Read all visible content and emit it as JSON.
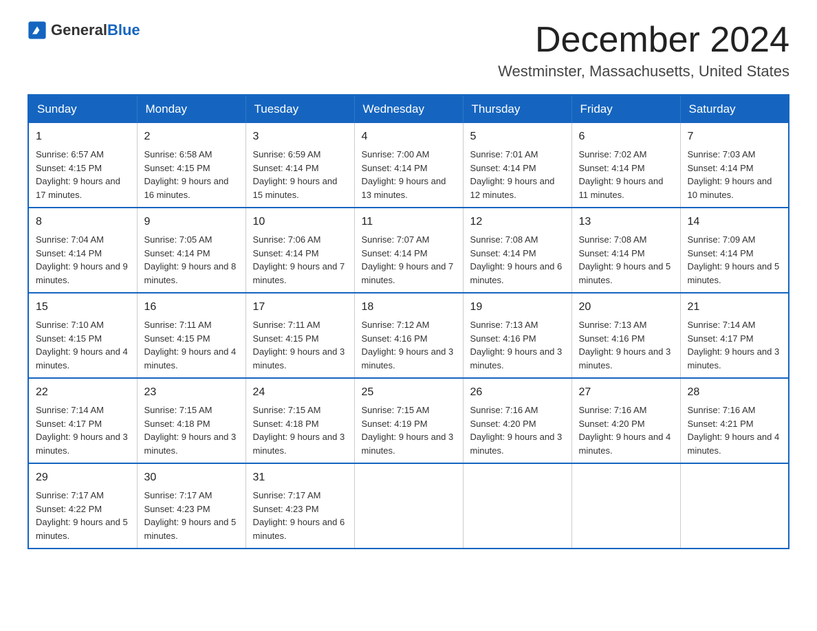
{
  "logo": {
    "text_general": "General",
    "text_blue": "Blue"
  },
  "title": "December 2024",
  "location": "Westminster, Massachusetts, United States",
  "days_of_week": [
    "Sunday",
    "Monday",
    "Tuesday",
    "Wednesday",
    "Thursday",
    "Friday",
    "Saturday"
  ],
  "weeks": [
    [
      {
        "day": "1",
        "sunrise": "Sunrise: 6:57 AM",
        "sunset": "Sunset: 4:15 PM",
        "daylight": "Daylight: 9 hours and 17 minutes."
      },
      {
        "day": "2",
        "sunrise": "Sunrise: 6:58 AM",
        "sunset": "Sunset: 4:15 PM",
        "daylight": "Daylight: 9 hours and 16 minutes."
      },
      {
        "day": "3",
        "sunrise": "Sunrise: 6:59 AM",
        "sunset": "Sunset: 4:14 PM",
        "daylight": "Daylight: 9 hours and 15 minutes."
      },
      {
        "day": "4",
        "sunrise": "Sunrise: 7:00 AM",
        "sunset": "Sunset: 4:14 PM",
        "daylight": "Daylight: 9 hours and 13 minutes."
      },
      {
        "day": "5",
        "sunrise": "Sunrise: 7:01 AM",
        "sunset": "Sunset: 4:14 PM",
        "daylight": "Daylight: 9 hours and 12 minutes."
      },
      {
        "day": "6",
        "sunrise": "Sunrise: 7:02 AM",
        "sunset": "Sunset: 4:14 PM",
        "daylight": "Daylight: 9 hours and 11 minutes."
      },
      {
        "day": "7",
        "sunrise": "Sunrise: 7:03 AM",
        "sunset": "Sunset: 4:14 PM",
        "daylight": "Daylight: 9 hours and 10 minutes."
      }
    ],
    [
      {
        "day": "8",
        "sunrise": "Sunrise: 7:04 AM",
        "sunset": "Sunset: 4:14 PM",
        "daylight": "Daylight: 9 hours and 9 minutes."
      },
      {
        "day": "9",
        "sunrise": "Sunrise: 7:05 AM",
        "sunset": "Sunset: 4:14 PM",
        "daylight": "Daylight: 9 hours and 8 minutes."
      },
      {
        "day": "10",
        "sunrise": "Sunrise: 7:06 AM",
        "sunset": "Sunset: 4:14 PM",
        "daylight": "Daylight: 9 hours and 7 minutes."
      },
      {
        "day": "11",
        "sunrise": "Sunrise: 7:07 AM",
        "sunset": "Sunset: 4:14 PM",
        "daylight": "Daylight: 9 hours and 7 minutes."
      },
      {
        "day": "12",
        "sunrise": "Sunrise: 7:08 AM",
        "sunset": "Sunset: 4:14 PM",
        "daylight": "Daylight: 9 hours and 6 minutes."
      },
      {
        "day": "13",
        "sunrise": "Sunrise: 7:08 AM",
        "sunset": "Sunset: 4:14 PM",
        "daylight": "Daylight: 9 hours and 5 minutes."
      },
      {
        "day": "14",
        "sunrise": "Sunrise: 7:09 AM",
        "sunset": "Sunset: 4:14 PM",
        "daylight": "Daylight: 9 hours and 5 minutes."
      }
    ],
    [
      {
        "day": "15",
        "sunrise": "Sunrise: 7:10 AM",
        "sunset": "Sunset: 4:15 PM",
        "daylight": "Daylight: 9 hours and 4 minutes."
      },
      {
        "day": "16",
        "sunrise": "Sunrise: 7:11 AM",
        "sunset": "Sunset: 4:15 PM",
        "daylight": "Daylight: 9 hours and 4 minutes."
      },
      {
        "day": "17",
        "sunrise": "Sunrise: 7:11 AM",
        "sunset": "Sunset: 4:15 PM",
        "daylight": "Daylight: 9 hours and 3 minutes."
      },
      {
        "day": "18",
        "sunrise": "Sunrise: 7:12 AM",
        "sunset": "Sunset: 4:16 PM",
        "daylight": "Daylight: 9 hours and 3 minutes."
      },
      {
        "day": "19",
        "sunrise": "Sunrise: 7:13 AM",
        "sunset": "Sunset: 4:16 PM",
        "daylight": "Daylight: 9 hours and 3 minutes."
      },
      {
        "day": "20",
        "sunrise": "Sunrise: 7:13 AM",
        "sunset": "Sunset: 4:16 PM",
        "daylight": "Daylight: 9 hours and 3 minutes."
      },
      {
        "day": "21",
        "sunrise": "Sunrise: 7:14 AM",
        "sunset": "Sunset: 4:17 PM",
        "daylight": "Daylight: 9 hours and 3 minutes."
      }
    ],
    [
      {
        "day": "22",
        "sunrise": "Sunrise: 7:14 AM",
        "sunset": "Sunset: 4:17 PM",
        "daylight": "Daylight: 9 hours and 3 minutes."
      },
      {
        "day": "23",
        "sunrise": "Sunrise: 7:15 AM",
        "sunset": "Sunset: 4:18 PM",
        "daylight": "Daylight: 9 hours and 3 minutes."
      },
      {
        "day": "24",
        "sunrise": "Sunrise: 7:15 AM",
        "sunset": "Sunset: 4:18 PM",
        "daylight": "Daylight: 9 hours and 3 minutes."
      },
      {
        "day": "25",
        "sunrise": "Sunrise: 7:15 AM",
        "sunset": "Sunset: 4:19 PM",
        "daylight": "Daylight: 9 hours and 3 minutes."
      },
      {
        "day": "26",
        "sunrise": "Sunrise: 7:16 AM",
        "sunset": "Sunset: 4:20 PM",
        "daylight": "Daylight: 9 hours and 3 minutes."
      },
      {
        "day": "27",
        "sunrise": "Sunrise: 7:16 AM",
        "sunset": "Sunset: 4:20 PM",
        "daylight": "Daylight: 9 hours and 4 minutes."
      },
      {
        "day": "28",
        "sunrise": "Sunrise: 7:16 AM",
        "sunset": "Sunset: 4:21 PM",
        "daylight": "Daylight: 9 hours and 4 minutes."
      }
    ],
    [
      {
        "day": "29",
        "sunrise": "Sunrise: 7:17 AM",
        "sunset": "Sunset: 4:22 PM",
        "daylight": "Daylight: 9 hours and 5 minutes."
      },
      {
        "day": "30",
        "sunrise": "Sunrise: 7:17 AM",
        "sunset": "Sunset: 4:23 PM",
        "daylight": "Daylight: 9 hours and 5 minutes."
      },
      {
        "day": "31",
        "sunrise": "Sunrise: 7:17 AM",
        "sunset": "Sunset: 4:23 PM",
        "daylight": "Daylight: 9 hours and 6 minutes."
      },
      {
        "day": "",
        "sunrise": "",
        "sunset": "",
        "daylight": ""
      },
      {
        "day": "",
        "sunrise": "",
        "sunset": "",
        "daylight": ""
      },
      {
        "day": "",
        "sunrise": "",
        "sunset": "",
        "daylight": ""
      },
      {
        "day": "",
        "sunrise": "",
        "sunset": "",
        "daylight": ""
      }
    ]
  ]
}
